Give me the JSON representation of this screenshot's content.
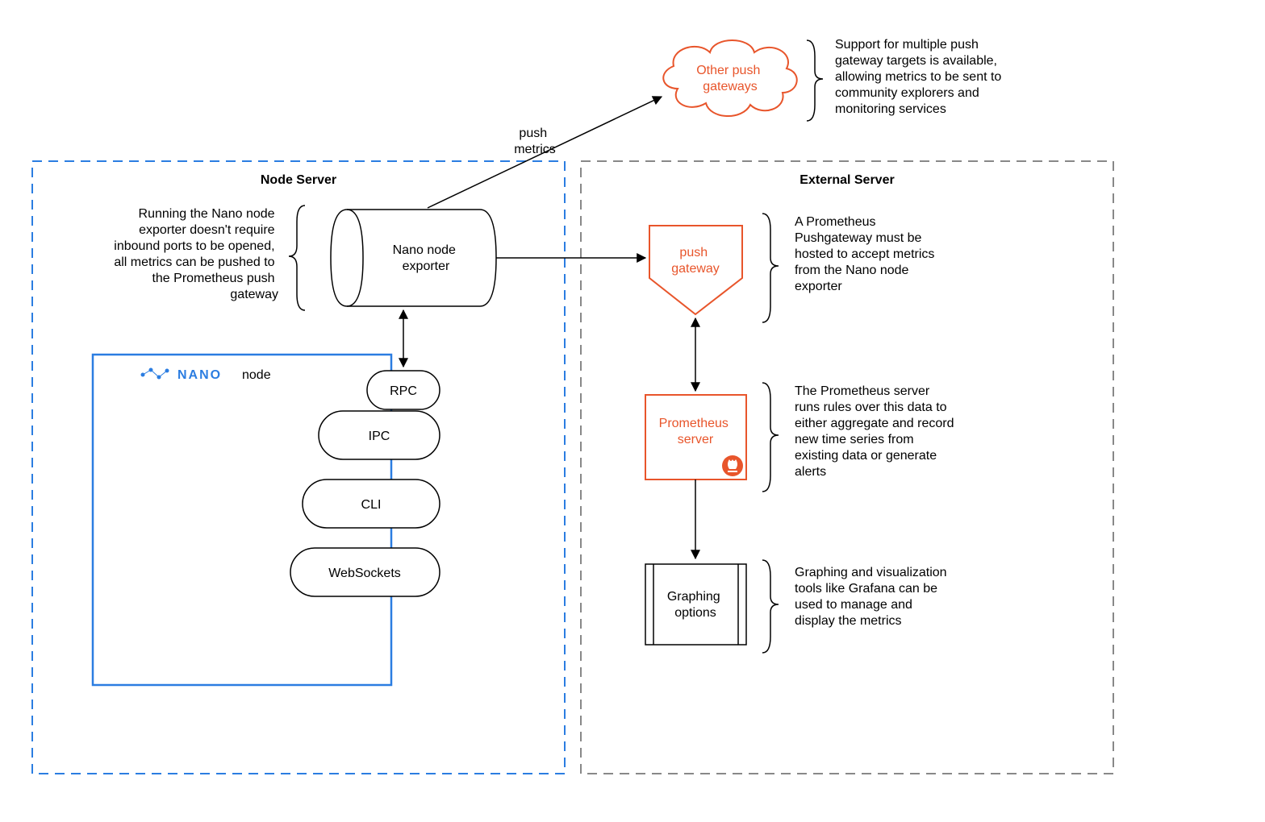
{
  "colors": {
    "blue": "#2b7de1",
    "orange": "#e8552b",
    "gray": "#888888",
    "black": "#000000"
  },
  "nodeServer": {
    "title": "Node Server",
    "exporterDesc": "Running the Nano node\nexporter doesn't require\ninbound ports to be opened,\nall metrics can be pushed to\nthe Prometheus push\ngateway",
    "nanoNodeLabel": "node",
    "nanoLogoText": "NANO",
    "exporter": "Nano node\nexporter",
    "protocols": {
      "rpc": "RPC",
      "ipc": "IPC",
      "cli": "CLI",
      "websockets": "WebSockets"
    }
  },
  "externalServer": {
    "title": "External Server",
    "pushGateway": "push\ngateway",
    "pushGatewayDesc": "A Prometheus\nPushgateway must be\nhosted to accept metrics\nfrom the Nano node\nexporter",
    "prometheus": "Prometheus\nserver",
    "prometheusDesc": "The Prometheus server\nruns rules over this data to\neither aggregate and record\nnew time series from\nexisting data or generate\nalerts",
    "graphing": "Graphing\noptions",
    "graphingDesc": "Graphing and visualization\ntools like Grafana can be\nused to manage and\ndisplay the metrics"
  },
  "otherGateways": {
    "label": "Other push\ngateways",
    "desc": "Support for multiple push\ngateway targets is available,\nallowing metrics to be sent to\ncommunity explorers and\nmonitoring services",
    "pushMetricsLabel": "push\nmetrics"
  }
}
